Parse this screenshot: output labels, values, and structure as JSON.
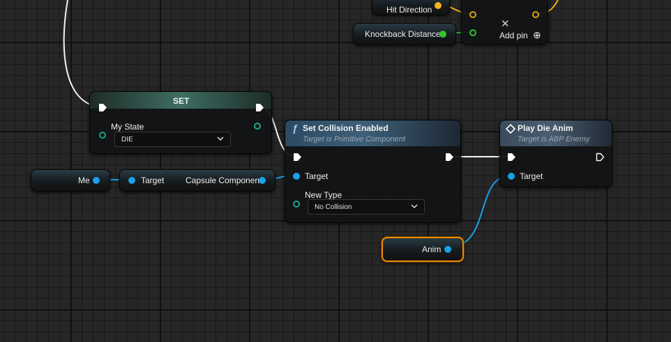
{
  "colors": {
    "exec": "#ffffff",
    "object": "#1aa0e8",
    "vector": "#f5b21c",
    "float": "#31c42e",
    "enum": "#17a78a",
    "select_outline": "#f08a00"
  },
  "top": {
    "hit_direction": "Hit Direction",
    "knockback_distance": "Knockback Distance",
    "add_pin": "Add pin",
    "x_icon": "✕",
    "plus_icon": "⊕"
  },
  "set_node": {
    "title": "SET",
    "var_label": "My State",
    "value": "DIE"
  },
  "me_node": {
    "label": "Me"
  },
  "capsule_node": {
    "target": "Target",
    "output": "Capsule Component"
  },
  "collision_node": {
    "func_icon": "ƒ",
    "title": "Set Collision Enabled",
    "subtitle": "Target is Primitive Component",
    "target": "Target",
    "new_type_label": "New Type",
    "new_type_value": "No Collision"
  },
  "die_node": {
    "title": "Play Die Anim",
    "subtitle": "Target is ABP Enemy",
    "target": "Target"
  },
  "anim_node": {
    "label": "Anim"
  }
}
